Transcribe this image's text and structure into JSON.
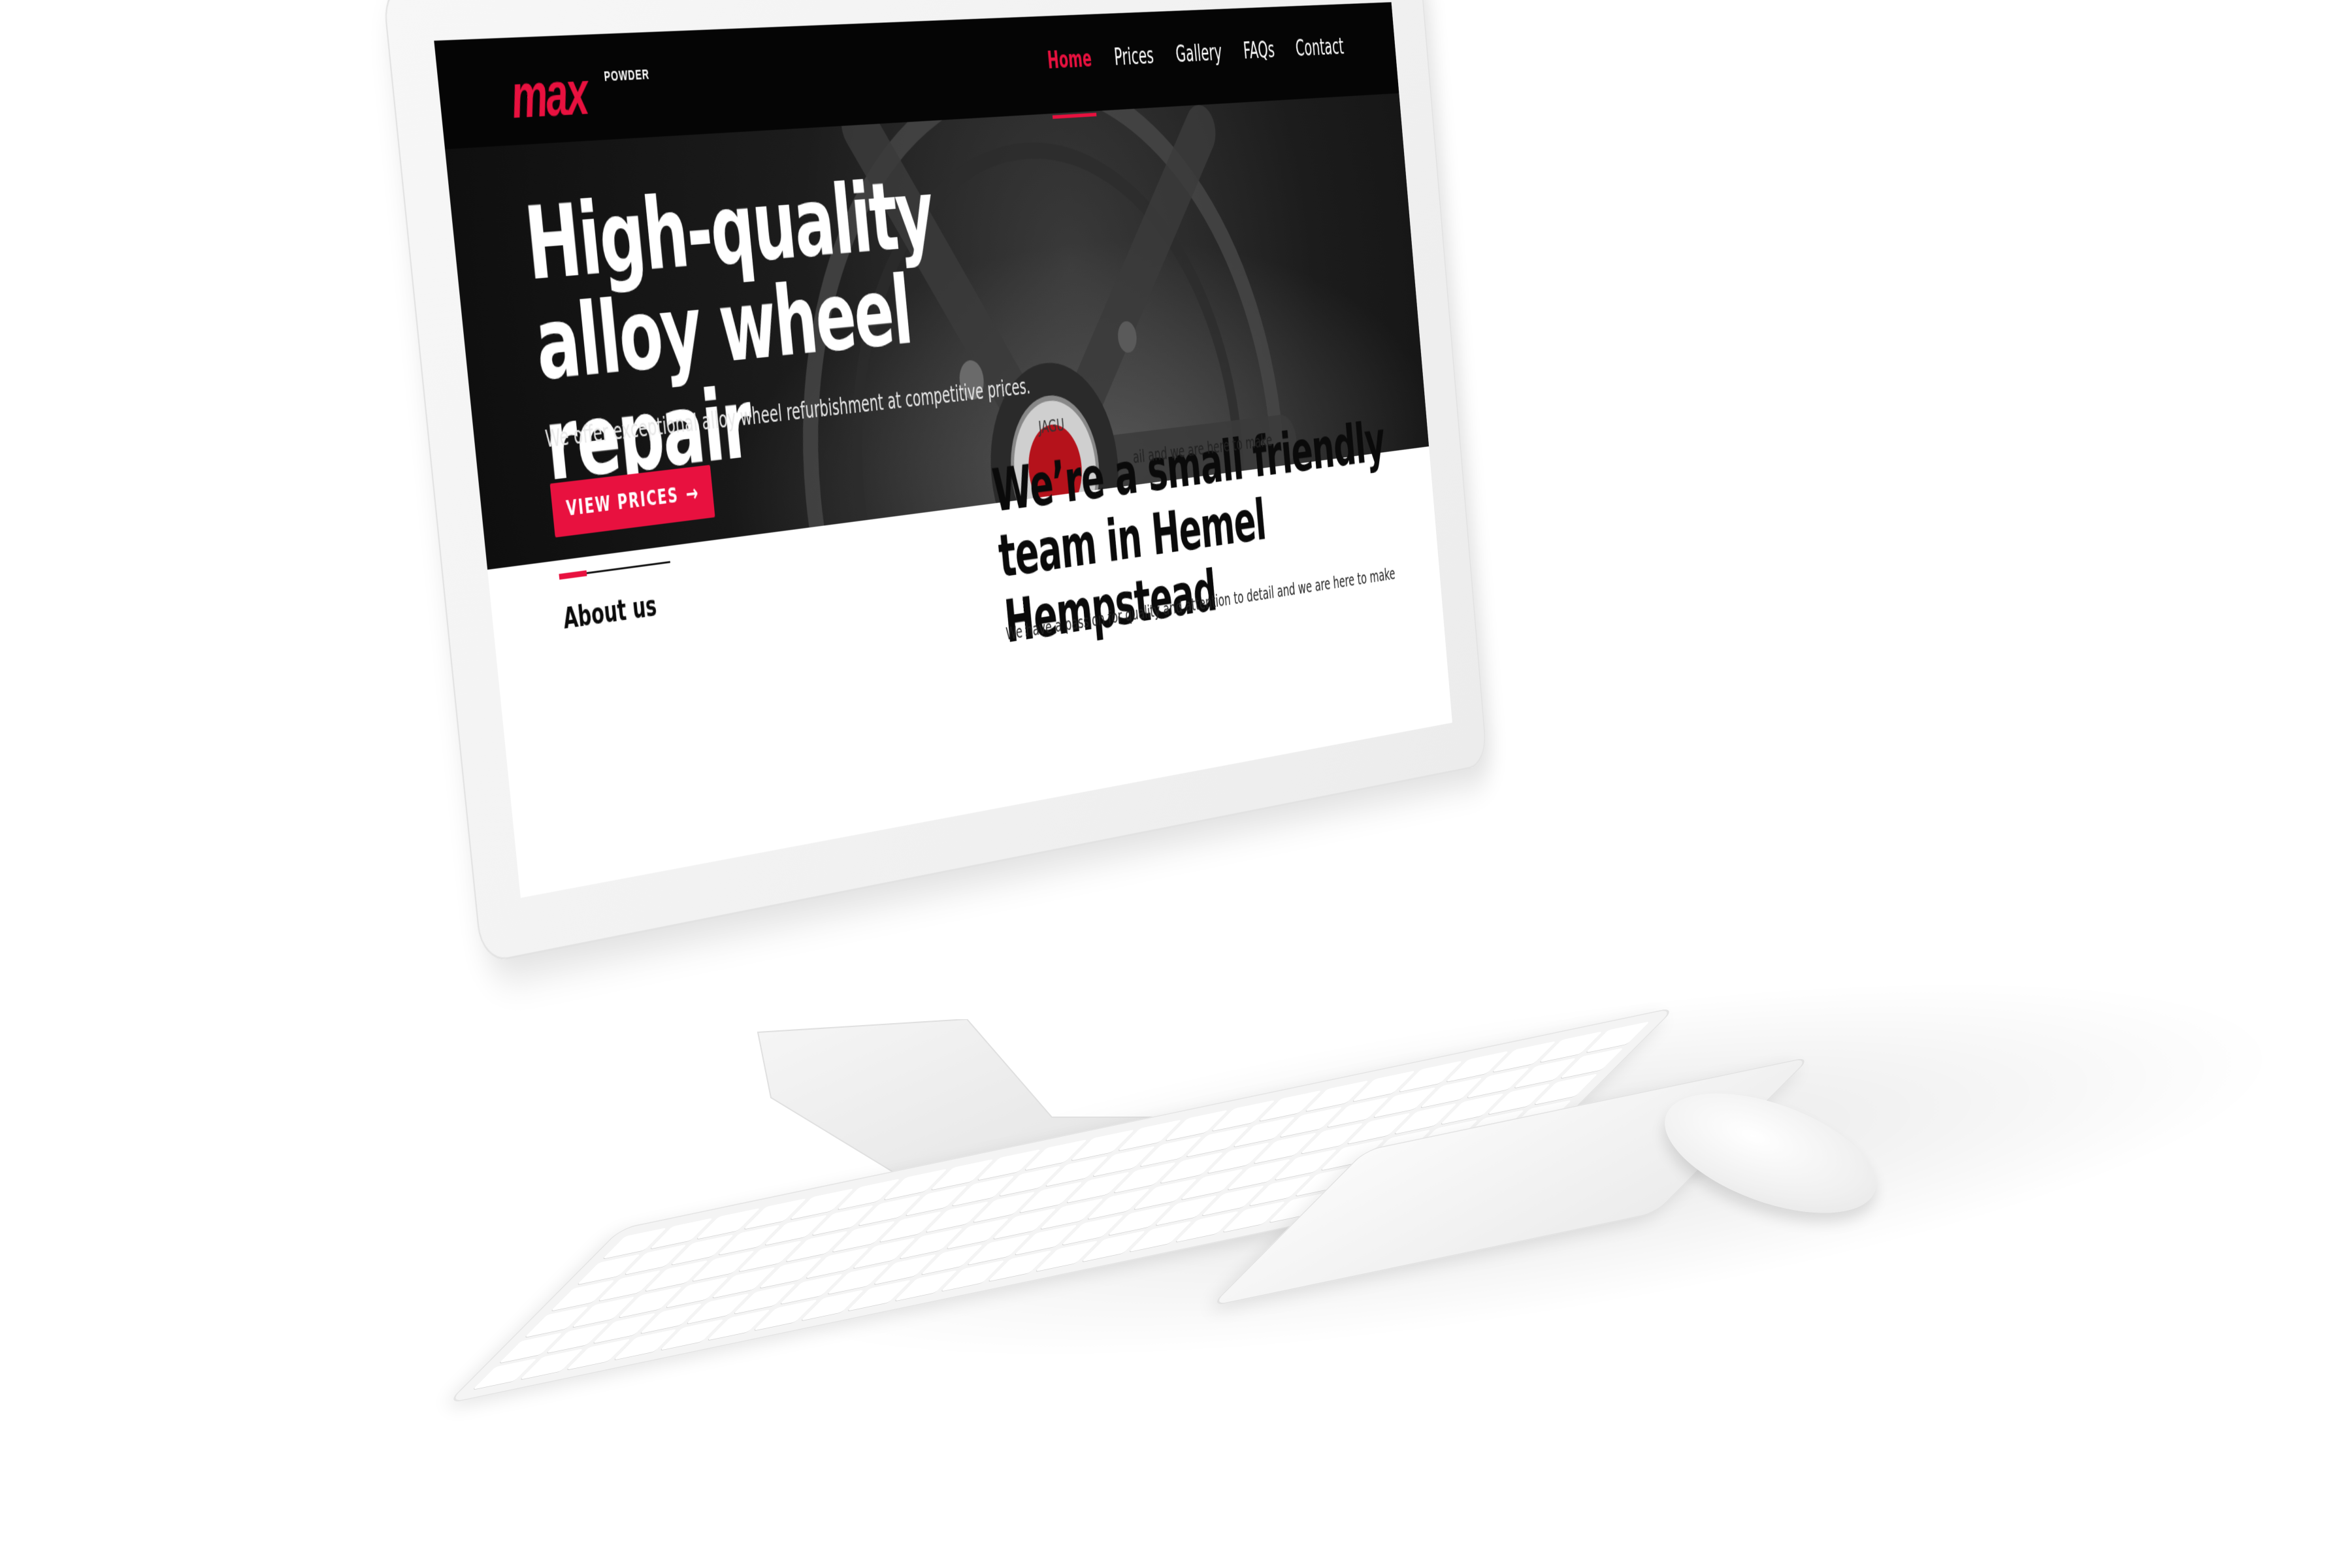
{
  "site": {
    "logo": {
      "mark": "max",
      "sub": "POWDER"
    },
    "nav": [
      {
        "label": "Home",
        "active": true
      },
      {
        "label": "Prices",
        "active": false
      },
      {
        "label": "Gallery",
        "active": false
      },
      {
        "label": "FAQs",
        "active": false
      },
      {
        "label": "Contact",
        "active": false
      }
    ],
    "hero": {
      "title": "High-quality alloy wheel repair",
      "subtitle": "We offer exceptional alloy wheel refurbishment at competitive prices.",
      "cta_label": "VIEW PRICES",
      "badge_text": "JAGU"
    },
    "about": {
      "label": "About us",
      "heading": "We’re a small friendly team in Hemel Hempstead",
      "body_top": "ail and we are here to make",
      "body": "We have a passion for quality and attention to detail and we are here to make"
    }
  },
  "colors": {
    "accent": "#e8113f",
    "header_bg": "#050505",
    "device_body": "#f2f2f2"
  },
  "icons": {
    "cta_arrow": "arrow-right-icon"
  }
}
